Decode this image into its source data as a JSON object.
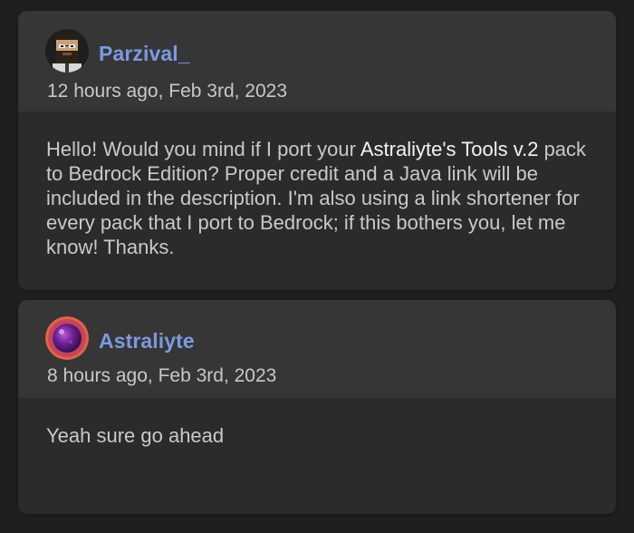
{
  "colors": {
    "page_background": "#1f1f20",
    "card_background": "#2b2b2c",
    "header_background": "#363637",
    "username": "#7d99e0",
    "text": "#c9c9c9",
    "link_text": "#f4f4f4"
  },
  "comments": [
    {
      "avatar_icon": "pixel-bearded-man-avatar",
      "username": "Parzival_",
      "timestamp": "12 hours ago, Feb 3rd, 2023",
      "body_before": "Hello! Would you mind if I port your ",
      "link_text": "Astraliyte's Tools v.2",
      "body_after": " pack to Bedrock Edition? Proper credit and a Java link will be included in the description. I'm also using a link shortener for every pack that I port to Bedrock; if this bothers you, let me know! Thanks."
    },
    {
      "avatar_icon": "purple-orb-avatar",
      "username": "Astraliyte",
      "timestamp": "8 hours ago, Feb 3rd, 2023",
      "body": "Yeah sure go ahead"
    }
  ]
}
